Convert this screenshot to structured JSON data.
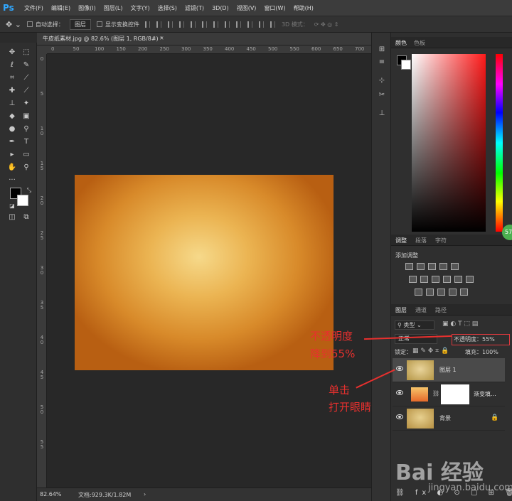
{
  "app": {
    "logo": "Ps"
  },
  "menu": [
    "文件(F)",
    "编辑(E)",
    "图像(I)",
    "图层(L)",
    "文字(Y)",
    "选择(S)",
    "滤镜(T)",
    "3D(D)",
    "视图(V)",
    "窗口(W)",
    "帮助(H)"
  ],
  "options": {
    "auto_select": "自动选择：",
    "auto_select_value": "图层",
    "show_transform": "显示变换控件",
    "mode_3d": "3D 模式："
  },
  "document": {
    "tab_title": "牛皮纸素材.jpg @ 82.6% (图层 1, RGB/8#) *",
    "zoom": "82.64%",
    "doc_info": "文档:929.3K/1.82M"
  },
  "ruler_h": [
    "0",
    "50",
    "100",
    "150",
    "200",
    "250",
    "300",
    "350",
    "400",
    "450",
    "500",
    "550",
    "600",
    "650",
    "700"
  ],
  "ruler_v": [
    "0",
    "5",
    "1 0",
    "1 5",
    "2 0",
    "2 5",
    "3 0",
    "3 5",
    "4 0",
    "4 5",
    "5 0",
    "5 5"
  ],
  "panels": {
    "color_tabs": [
      "颜色",
      "色板"
    ],
    "adjust_tabs": [
      "调整",
      "段落",
      "字符"
    ],
    "adjust_title": "添加调整",
    "layers_tabs": [
      "图层",
      "通道",
      "路径"
    ],
    "filter_kind": "类型",
    "blend_mode": "正常",
    "opacity_label": "不透明度：",
    "opacity_value": "55%",
    "lock_label": "锁定：",
    "fill_label": "填充：",
    "fill_value": "100%",
    "colors": {
      "fg": "#000000",
      "bg": "#ffffff"
    }
  },
  "layers": [
    {
      "name": "图层 1",
      "visible": true,
      "selected": true
    },
    {
      "name": "渐变填...",
      "visible": true,
      "selected": false
    },
    {
      "name": "背景",
      "visible": true,
      "selected": false,
      "locked": true
    }
  ],
  "annotations": {
    "opacity_note_line1": "不透明度",
    "opacity_note_line2": "降到55%",
    "click_note_line1": "单击",
    "click_note_line2": "打开眼睛"
  },
  "watermark": {
    "brand": "Bai 经验",
    "url": "jingyan.baidu.com"
  },
  "badge": "57"
}
